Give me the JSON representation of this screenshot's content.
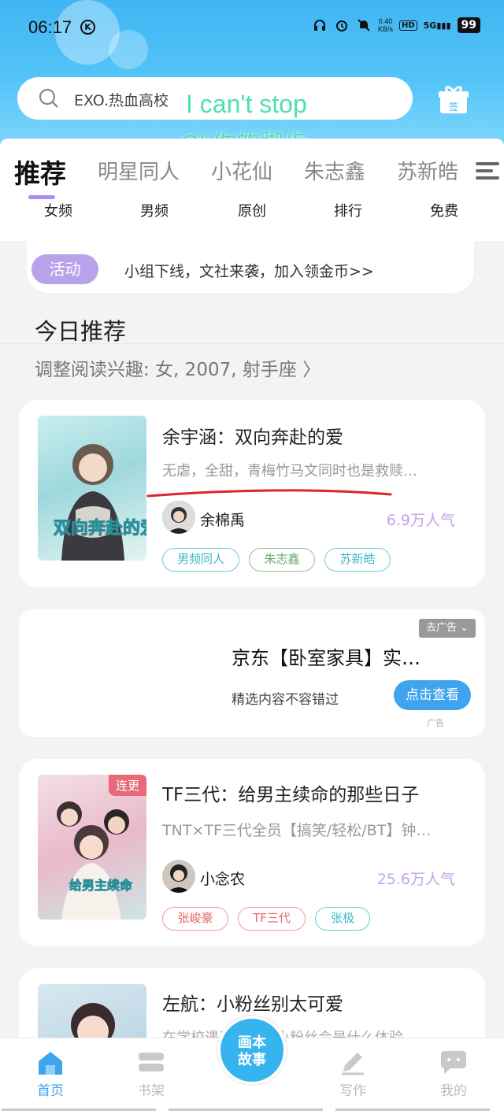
{
  "status_bar": {
    "time": "06:17",
    "net_speed": "0.40\nKB/s",
    "hd": "HD",
    "signal": "5G",
    "battery": "99"
  },
  "search": {
    "text": "EXO.热血高校",
    "lyric_line1": "I can't stop",
    "lyric_line2": "Oh你的脚步",
    "gift_label": "签"
  },
  "tabs": [
    "推荐",
    "明星同人",
    "小花仙",
    "朱志鑫",
    "苏新皓"
  ],
  "subtabs": [
    "女频",
    "男频",
    "原创",
    "排行",
    "免费"
  ],
  "activity": {
    "badge": "活动",
    "text": "小组下线，文社来袭，加入领金币>>"
  },
  "section": {
    "title": "今日推荐",
    "subtitle": "调整阅读兴趣: 女, 2007, 射手座 〉"
  },
  "books": [
    {
      "title": "余宇涵：双向奔赴的爱",
      "desc": "无虐，全甜，青梅竹马文同时也是救赎…",
      "author": "余棉禹",
      "popularity": "6.9万人气",
      "tags": [
        "男频同人",
        "朱志鑫",
        "苏新皓"
      ],
      "cover_text": "双向奔赴的爱"
    },
    {
      "title": "TF三代：给男主续命的那些日子",
      "desc": "TNT×TF三代全员【搞笑/轻松/BT】钟…",
      "author": "小念农",
      "popularity": "25.6万人气",
      "tags": [
        "张峻豪",
        "TF三代",
        "张极"
      ],
      "badge": "连更",
      "cover_text": "给男主续命"
    },
    {
      "title": "左航：小粉丝别太可爱",
      "desc": "在学校遇到偶像的小粉丝会是什么体验…"
    }
  ],
  "ad": {
    "close_label": "去广告 ⌄",
    "title": "京东【卧室家具】实…",
    "desc": "精选内容不容错过",
    "button": "点击查看",
    "label": "广告"
  },
  "bottom_nav": {
    "items": [
      "首页",
      "书架",
      "写作",
      "我的"
    ],
    "center": "画本\n故事"
  },
  "colors": {
    "accent": "#3fa3ee",
    "header_blue": "#3fb6f3",
    "purple": "#b9a2ec",
    "popularity": "#c4a4ea"
  }
}
